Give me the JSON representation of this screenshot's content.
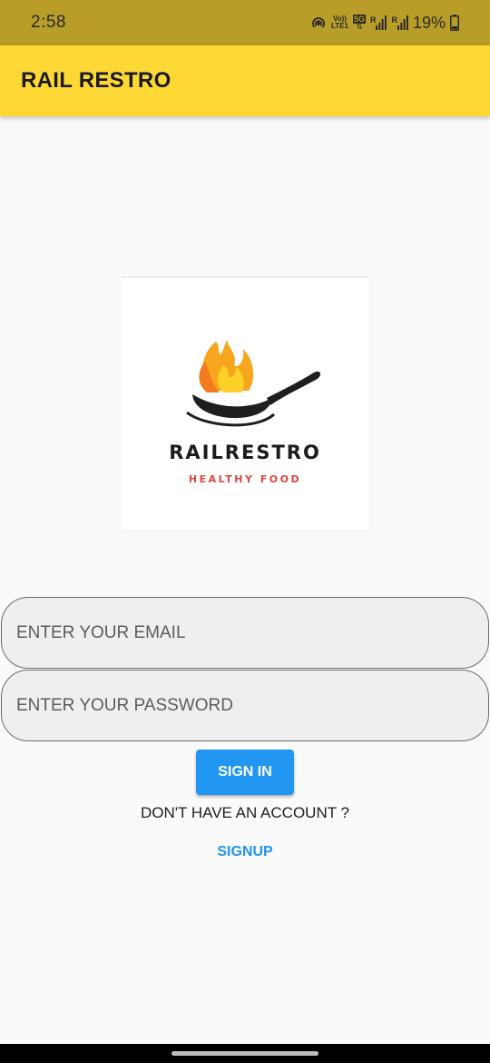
{
  "status_bar": {
    "time": "2:58",
    "volte_label_top": "Vo))",
    "volte_label_bottom": "LTE1",
    "network_label": "5G",
    "signal_1_label": "R",
    "signal_2_label": "R",
    "battery": "19%"
  },
  "app_bar": {
    "title": "RAIL RESTRO"
  },
  "logo": {
    "name": "RAILRESTRO",
    "tagline": "HEALTHY FOOD",
    "icon": "flaming-pan-icon"
  },
  "form": {
    "email_placeholder": "ENTER YOUR EMAIL",
    "email_value": "",
    "password_placeholder": "ENTER YOUR PASSWORD",
    "password_value": "",
    "sign_in_label": "SIGN IN",
    "no_account_text": "DON'T HAVE AN ACCOUNT ?",
    "signup_label": "SIGNUP"
  },
  "colors": {
    "status_bar": "#b89e28",
    "app_bar": "#fdd835",
    "primary": "#2196f3",
    "tagline": "#e0443c"
  }
}
